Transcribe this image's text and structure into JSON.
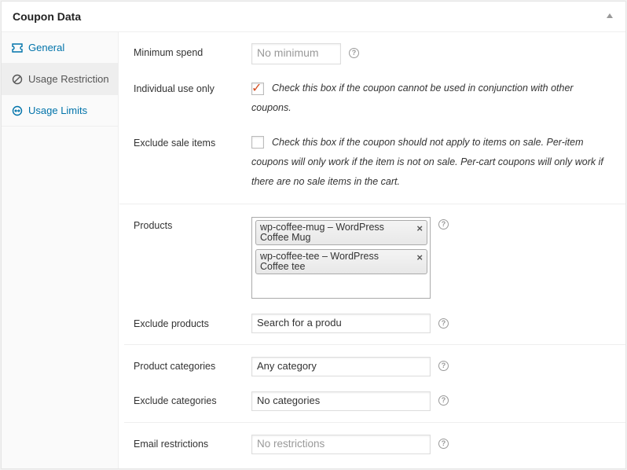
{
  "header": {
    "title": "Coupon Data"
  },
  "tabs": [
    {
      "label": "General",
      "icon": "ticket-icon"
    },
    {
      "label": "Usage Restriction",
      "icon": "restriction-icon"
    },
    {
      "label": "Usage Limits",
      "icon": "limits-icon"
    }
  ],
  "fields": {
    "minimum_spend": {
      "label": "Minimum spend",
      "placeholder": "No minimum"
    },
    "individual_use": {
      "label": "Individual use only",
      "checked": true,
      "desc_line1": "Check this box if the coupon cannot be used in conjunction with other",
      "desc_line2": "coupons."
    },
    "exclude_sale": {
      "label": "Exclude sale items",
      "checked": false,
      "desc_line1": "Check this box if the coupon should not apply to items on sale. Per-item",
      "desc_line2": "coupons will only work if the item is not on sale. Per-cart coupons will only work if",
      "desc_line3": "there are no sale items in the cart."
    },
    "products": {
      "label": "Products",
      "items": [
        {
          "line1": "wp-coffee-mug – WordPress",
          "line2": "Coffee Mug"
        },
        {
          "line1": "wp-coffee-tee – WordPress",
          "line2": "Coffee tee"
        }
      ],
      "remove_glyph": "×"
    },
    "exclude_products": {
      "label": "Exclude products",
      "value": "Search for a produ"
    },
    "product_categories": {
      "label": "Product categories",
      "value": "Any category"
    },
    "exclude_categories": {
      "label": "Exclude categories",
      "value": "No categories"
    },
    "email_restrictions": {
      "label": "Email restrictions",
      "placeholder": "No restrictions"
    }
  },
  "help_glyph": "?",
  "check_glyph": "✓",
  "colors": {
    "link": "#0073aa",
    "checkmark": "#d54e21",
    "active_tab_bg": "#eeeeee"
  }
}
